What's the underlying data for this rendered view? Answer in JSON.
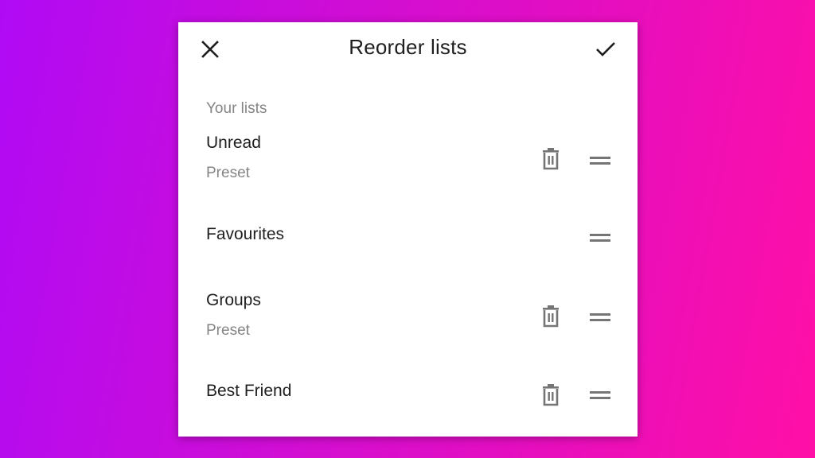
{
  "header": {
    "title": "Reorder lists",
    "close_icon": "close-icon",
    "confirm_icon": "check-icon"
  },
  "section": {
    "label": "Your lists"
  },
  "lists": [
    {
      "title": "Unread",
      "subtitle": "Preset",
      "deletable": true
    },
    {
      "title": "Favourites",
      "subtitle": "",
      "deletable": false
    },
    {
      "title": "Groups",
      "subtitle": "Preset",
      "deletable": true
    },
    {
      "title": "Best Friend",
      "subtitle": "",
      "deletable": true
    }
  ],
  "colors": {
    "icon_gray": "#757575",
    "text_primary": "#202020",
    "text_secondary": "#858585"
  }
}
